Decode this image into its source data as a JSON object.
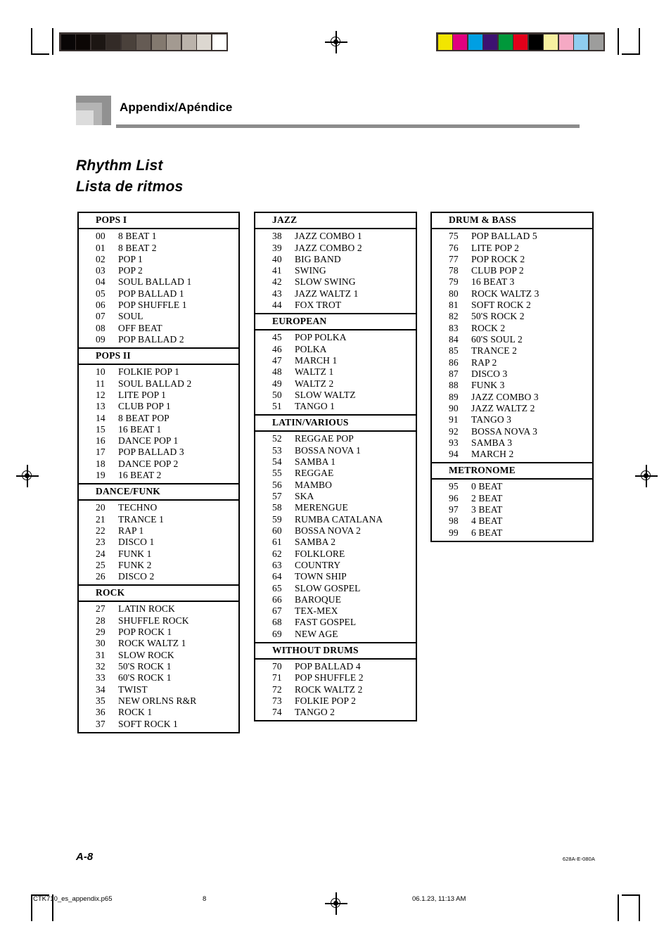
{
  "header": {
    "section_title": "Appendix/Apéndice",
    "logo_name": "casio-nested-square-logo"
  },
  "titles": {
    "english": "Rhythm List",
    "spanish": "Lista de ritmos"
  },
  "columns": [
    {
      "id": "col-1",
      "sections": [
        {
          "heading": "POPS  I",
          "rows": [
            {
              "num": "00",
              "name": "8 BEAT 1"
            },
            {
              "num": "01",
              "name": "8 BEAT 2"
            },
            {
              "num": "02",
              "name": "POP 1"
            },
            {
              "num": "03",
              "name": "POP 2"
            },
            {
              "num": "04",
              "name": "SOUL BALLAD 1"
            },
            {
              "num": "05",
              "name": "POP BALLAD 1"
            },
            {
              "num": "06",
              "name": "POP SHUFFLE 1"
            },
            {
              "num": "07",
              "name": "SOUL"
            },
            {
              "num": "08",
              "name": "OFF BEAT"
            },
            {
              "num": "09",
              "name": "POP BALLAD 2"
            }
          ]
        },
        {
          "heading": "POPS  II",
          "rows": [
            {
              "num": "10",
              "name": "FOLKIE POP 1"
            },
            {
              "num": "11",
              "name": "SOUL BALLAD 2"
            },
            {
              "num": "12",
              "name": "LITE POP 1"
            },
            {
              "num": "13",
              "name": "CLUB POP 1"
            },
            {
              "num": "14",
              "name": "8 BEAT POP"
            },
            {
              "num": "15",
              "name": "16 BEAT 1"
            },
            {
              "num": "16",
              "name": "DANCE POP 1"
            },
            {
              "num": "17",
              "name": "POP BALLAD 3"
            },
            {
              "num": "18",
              "name": "DANCE POP 2"
            },
            {
              "num": "19",
              "name": "16 BEAT 2"
            }
          ]
        },
        {
          "heading": "DANCE/FUNK",
          "rows": [
            {
              "num": "20",
              "name": "TECHNO"
            },
            {
              "num": "21",
              "name": "TRANCE 1"
            },
            {
              "num": "22",
              "name": "RAP 1"
            },
            {
              "num": "23",
              "name": "DISCO 1"
            },
            {
              "num": "24",
              "name": "FUNK 1"
            },
            {
              "num": "25",
              "name": "FUNK 2"
            },
            {
              "num": "26",
              "name": "DISCO 2"
            }
          ]
        },
        {
          "heading": "ROCK",
          "rows": [
            {
              "num": "27",
              "name": "LATIN ROCK"
            },
            {
              "num": "28",
              "name": "SHUFFLE ROCK"
            },
            {
              "num": "29",
              "name": "POP ROCK 1"
            },
            {
              "num": "30",
              "name": "ROCK WALTZ 1"
            },
            {
              "num": "31",
              "name": "SLOW ROCK"
            },
            {
              "num": "32",
              "name": "50'S ROCK 1"
            },
            {
              "num": "33",
              "name": "60'S ROCK 1"
            },
            {
              "num": "34",
              "name": "TWIST"
            },
            {
              "num": "35",
              "name": "NEW ORLNS R&R"
            },
            {
              "num": "36",
              "name": "ROCK 1"
            },
            {
              "num": "37",
              "name": "SOFT ROCK 1"
            }
          ]
        }
      ]
    },
    {
      "id": "col-2",
      "sections": [
        {
          "heading": "JAZZ",
          "rows": [
            {
              "num": "38",
              "name": "JAZZ COMBO 1"
            },
            {
              "num": "39",
              "name": "JAZZ COMBO 2"
            },
            {
              "num": "40",
              "name": "BIG BAND"
            },
            {
              "num": "41",
              "name": "SWING"
            },
            {
              "num": "42",
              "name": "SLOW SWING"
            },
            {
              "num": "43",
              "name": "JAZZ WALTZ 1"
            },
            {
              "num": "44",
              "name": "FOX TROT"
            }
          ]
        },
        {
          "heading": "EUROPEAN",
          "rows": [
            {
              "num": "45",
              "name": "POP POLKA"
            },
            {
              "num": "46",
              "name": "POLKA"
            },
            {
              "num": "47",
              "name": "MARCH 1"
            },
            {
              "num": "48",
              "name": "WALTZ 1"
            },
            {
              "num": "49",
              "name": "WALTZ 2"
            },
            {
              "num": "50",
              "name": "SLOW WALTZ"
            },
            {
              "num": "51",
              "name": "TANGO 1"
            }
          ]
        },
        {
          "heading": "LATIN/VARIOUS",
          "rows": [
            {
              "num": "52",
              "name": "REGGAE POP"
            },
            {
              "num": "53",
              "name": "BOSSA NOVA 1"
            },
            {
              "num": "54",
              "name": "SAMBA 1"
            },
            {
              "num": "55",
              "name": "REGGAE"
            },
            {
              "num": "56",
              "name": "MAMBO"
            },
            {
              "num": "57",
              "name": "SKA"
            },
            {
              "num": "58",
              "name": "MERENGUE"
            },
            {
              "num": "59",
              "name": "RUMBA CATALANA"
            },
            {
              "num": "60",
              "name": "BOSSA NOVA 2"
            },
            {
              "num": "61",
              "name": "SAMBA 2"
            },
            {
              "num": "62",
              "name": "FOLKLORE"
            },
            {
              "num": "63",
              "name": "COUNTRY"
            },
            {
              "num": "64",
              "name": "TOWN SHIP"
            },
            {
              "num": "65",
              "name": "SLOW GOSPEL"
            },
            {
              "num": "66",
              "name": "BAROQUE"
            },
            {
              "num": "67",
              "name": "TEX-MEX"
            },
            {
              "num": "68",
              "name": "FAST GOSPEL"
            },
            {
              "num": "69",
              "name": "NEW AGE"
            }
          ]
        },
        {
          "heading": "WITHOUT DRUMS",
          "rows": [
            {
              "num": "70",
              "name": "POP BALLAD 4"
            },
            {
              "num": "71",
              "name": "POP SHUFFLE 2"
            },
            {
              "num": "72",
              "name": "ROCK WALTZ 2"
            },
            {
              "num": "73",
              "name": "FOLKIE POP 2"
            },
            {
              "num": "74",
              "name": "TANGO 2"
            }
          ]
        }
      ]
    },
    {
      "id": "col-3",
      "sections": [
        {
          "heading": "DRUM & BASS",
          "rows": [
            {
              "num": "75",
              "name": "POP BALLAD 5"
            },
            {
              "num": "76",
              "name": "LITE POP 2"
            },
            {
              "num": "77",
              "name": "POP ROCK 2"
            },
            {
              "num": "78",
              "name": "CLUB POP 2"
            },
            {
              "num": "79",
              "name": "16 BEAT 3"
            },
            {
              "num": "80",
              "name": "ROCK WALTZ 3"
            },
            {
              "num": "81",
              "name": "SOFT ROCK 2"
            },
            {
              "num": "82",
              "name": "50'S ROCK 2"
            },
            {
              "num": "83",
              "name": "ROCK 2"
            },
            {
              "num": "84",
              "name": "60'S SOUL 2"
            },
            {
              "num": "85",
              "name": "TRANCE 2"
            },
            {
              "num": "86",
              "name": "RAP 2"
            },
            {
              "num": "87",
              "name": "DISCO 3"
            },
            {
              "num": "88",
              "name": "FUNK 3"
            },
            {
              "num": "89",
              "name": "JAZZ COMBO 3"
            },
            {
              "num": "90",
              "name": "JAZZ WALTZ 2"
            },
            {
              "num": "91",
              "name": "TANGO 3"
            },
            {
              "num": "92",
              "name": "BOSSA NOVA 3"
            },
            {
              "num": "93",
              "name": "SAMBA 3"
            },
            {
              "num": "94",
              "name": "MARCH 2"
            }
          ]
        },
        {
          "heading": "METRONOME",
          "rows": [
            {
              "num": "95",
              "name": "0 BEAT"
            },
            {
              "num": "96",
              "name": "2 BEAT"
            },
            {
              "num": "97",
              "name": "3 BEAT"
            },
            {
              "num": "98",
              "name": "4 BEAT"
            },
            {
              "num": "99",
              "name": "6 BEAT"
            }
          ]
        }
      ]
    }
  ],
  "footer": {
    "folio": "A-8",
    "part_code": "628A-E-080A",
    "print_file": "CTK710_es_appendix.p65",
    "print_page": "8",
    "print_date": "06.1.23, 11:13 AM"
  },
  "calibration": {
    "grayscale_patches": [
      "#090606",
      "#0c0705",
      "#1c1613",
      "#332b27",
      "#4a413b",
      "#655b54",
      "#83796f",
      "#a39a91",
      "#bbb3ab",
      "#dcd7d0",
      "#ffffff"
    ],
    "color_patches": [
      "#f2e500",
      "#e0007f",
      "#009fe3",
      "#3d1271",
      "#00983a",
      "#e2001a",
      "#000000",
      "#f7f0a0",
      "#f5a9c4",
      "#8fcdf0",
      "#9d9d9c"
    ]
  }
}
